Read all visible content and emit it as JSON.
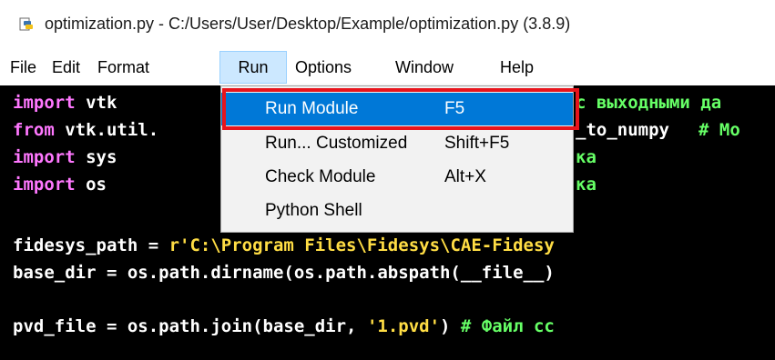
{
  "window": {
    "title": "optimization.py - C:/Users/User/Desktop/Example/optimization.py (3.8.9)"
  },
  "menubar": {
    "items": [
      {
        "label": "File"
      },
      {
        "label": "Edit"
      },
      {
        "label": "Format"
      },
      {
        "label": "Run"
      },
      {
        "label": "Options"
      },
      {
        "label": "Window"
      },
      {
        "label": "Help"
      }
    ]
  },
  "run_menu": {
    "items": [
      {
        "label": "Run Module",
        "shortcut": "F5"
      },
      {
        "label": "Run... Customized",
        "shortcut": "Shift+F5"
      },
      {
        "label": "Check Module",
        "shortcut": "Alt+X"
      },
      {
        "label": "Python Shell",
        "shortcut": ""
      }
    ]
  },
  "code": {
    "l1_kw": "import",
    "l1_rest": " vtk",
    "l2_kw": "from",
    "l2_rest": " vtk.util.",
    "l3_kw": "import",
    "l3_rest": " sys",
    "l4_kw": "import",
    "l4_rest": " os",
    "r1": "с выходными да",
    "r2a": "_to_numpy ",
    "r2b": "# Мо",
    "r3": "ка",
    "r4": "ка",
    "l5a": "fidesys_path = ",
    "l5b": "r'C:\\Program Files\\Fidesys\\CAE-Fidesy",
    "l6": "base_dir = os.path.dirname(os.path.abspath(__file__)",
    "l7a": "pvd_file = os.path.join(base_dir, ",
    "l7b": "'1.pvd'",
    "l7c": ") ",
    "l7d": "# Файл сс"
  },
  "colors": {
    "keyword": "#ff77ff",
    "string": "#ffdd44",
    "comment": "#66ff66",
    "menu_highlight": "#0078d7",
    "annotation_box": "#e8141c"
  }
}
